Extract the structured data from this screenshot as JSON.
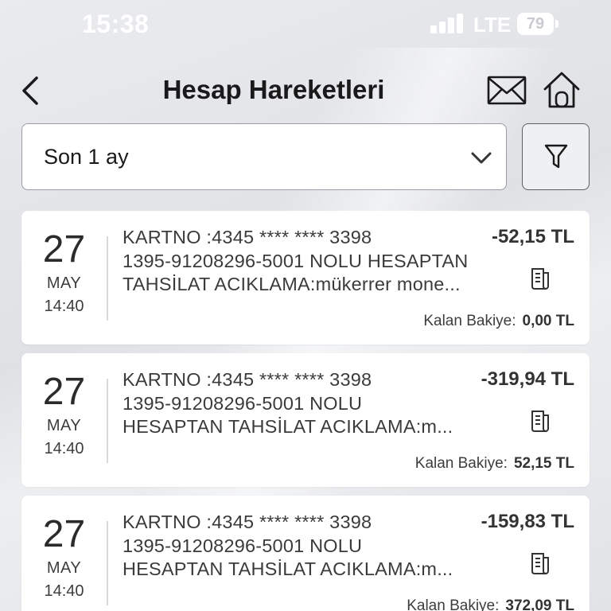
{
  "status_bar": {
    "time": "15:38",
    "network": "LTE",
    "battery": "79"
  },
  "header": {
    "title": "Hesap Hareketleri",
    "icons": [
      "back-chevron-icon",
      "mail-icon",
      "home-icon"
    ]
  },
  "filter": {
    "period_value": "Son 1 ay",
    "icons": [
      "chevron-down-icon",
      "funnel-icon"
    ]
  },
  "balance_label": "Kalan Bakiye:",
  "transactions": [
    {
      "day": "27",
      "month": "MAY",
      "time": "14:40",
      "line1": "KARTNO :4345 **** **** 3398",
      "line2": "1395-91208296-5001 NOLU HESAPTAN",
      "line3": "TAHSİLAT ACIKLAMA:mükerrer mone...",
      "amount": "-52,15 TL",
      "balance": "0,00 TL"
    },
    {
      "day": "27",
      "month": "MAY",
      "time": "14:40",
      "line1": "KARTNO :4345 **** **** 3398",
      "line2": "1395-91208296-5001 NOLU",
      "line3": "HESAPTAN TAHSİLAT ACIKLAMA:m...",
      "amount": "-319,94 TL",
      "balance": "52,15 TL"
    },
    {
      "day": "27",
      "month": "MAY",
      "time": "14:40",
      "line1": "KARTNO :4345 **** **** 3398",
      "line2": "1395-91208296-5001 NOLU",
      "line3": "HESAPTAN TAHSİLAT ACIKLAMA:m...",
      "amount": "-159,83 TL",
      "balance": "372,09 TL"
    }
  ]
}
